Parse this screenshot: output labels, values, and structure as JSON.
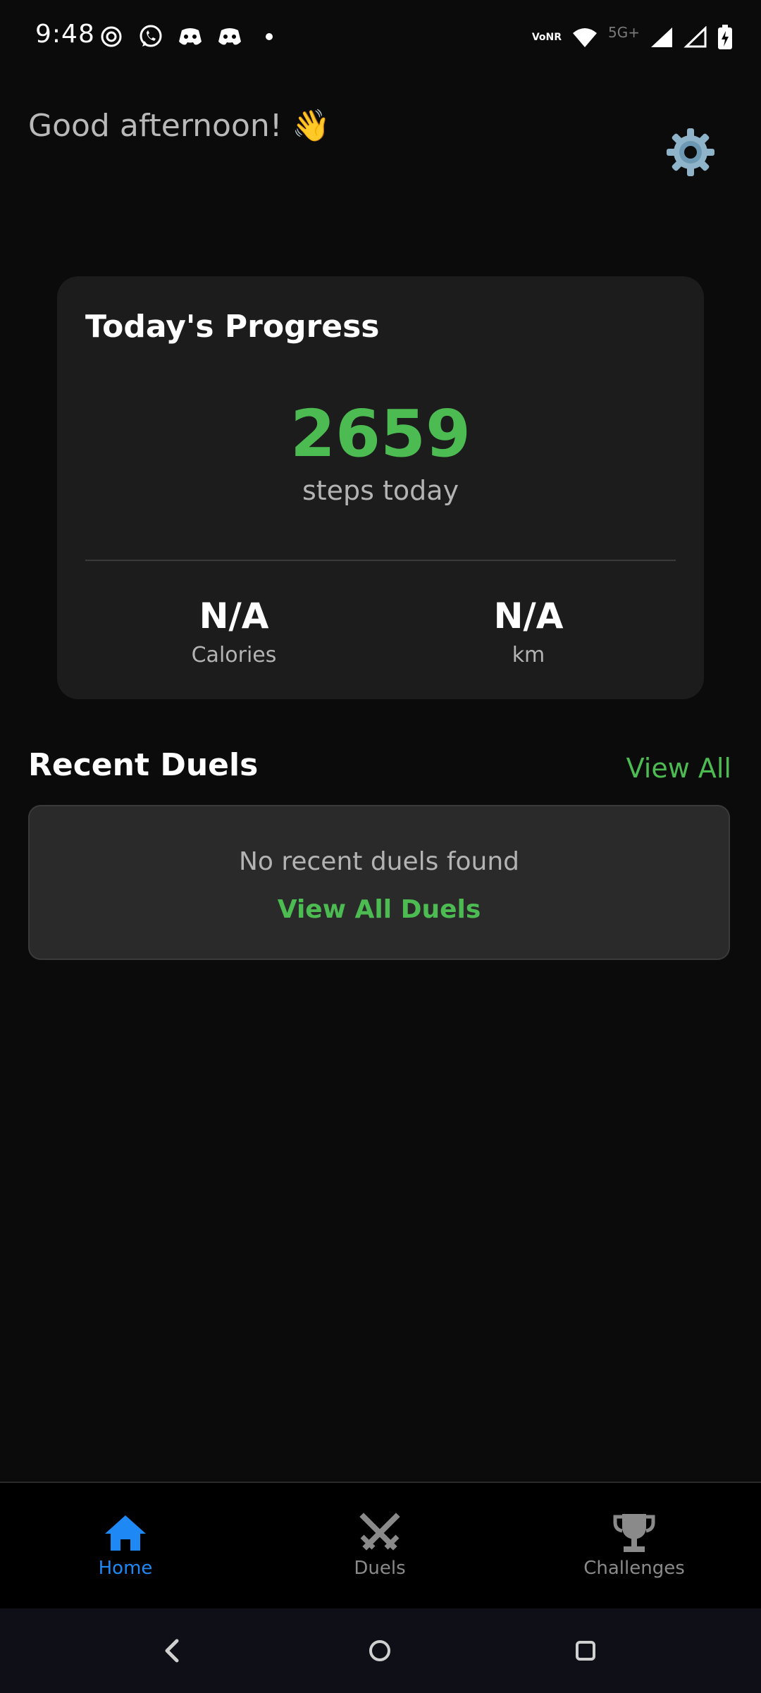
{
  "status_bar": {
    "time": "9:48",
    "left_icons": [
      "focus-mode-icon",
      "whatsapp-icon",
      "discord-icon",
      "discord-icon",
      "dot-icon"
    ],
    "volte_top": "Vo",
    "volte_bottom": "NR",
    "network_label": "5G+",
    "right_icons": [
      "volte-icon",
      "wifi-icon",
      "signal-icon",
      "signal-icon",
      "battery-charging-icon"
    ]
  },
  "header": {
    "greeting": "Good afternoon! 👋",
    "settings_icon": "gear-icon"
  },
  "progress": {
    "title": "Today's Progress",
    "steps": "2659",
    "steps_label": "steps today",
    "calories_value": "N/A",
    "calories_label": "Calories",
    "distance_value": "N/A",
    "distance_label": "km"
  },
  "recent_duels": {
    "title": "Recent Duels",
    "view_all": "View All",
    "empty_message": "No recent duels found",
    "view_all_duels": "View All Duels"
  },
  "tabs": [
    {
      "label": "Home",
      "icon": "home-icon",
      "active": true
    },
    {
      "label": "Duels",
      "icon": "crossed-swords-icon",
      "active": false
    },
    {
      "label": "Challenges",
      "icon": "trophy-icon",
      "active": false
    }
  ],
  "system_nav": {
    "back_icon": "back-chevron-icon",
    "home_icon": "home-circle-icon",
    "recents_icon": "recents-square-icon"
  },
  "colors": {
    "accent_green": "#4cbb52",
    "active_tab_blue": "#1e88f5",
    "background": "#0b0b0b",
    "card": "#1c1c1c"
  }
}
